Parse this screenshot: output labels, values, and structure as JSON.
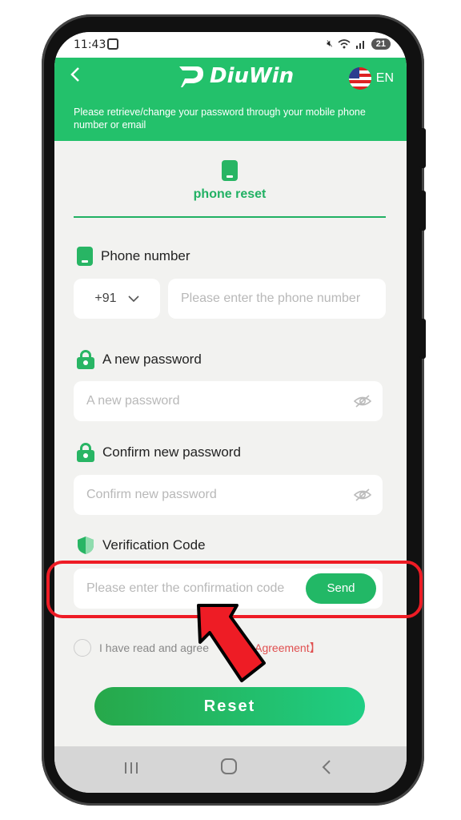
{
  "status_bar": {
    "time": "11:43",
    "battery": "21"
  },
  "header": {
    "back_icon": "chevron-left-icon",
    "brand": "DiuWin",
    "language": "EN",
    "description": "Please retrieve/change your password through your mobile phone number or email"
  },
  "tab": {
    "label": "phone reset"
  },
  "phone_section": {
    "label": "Phone number",
    "country_code": "+91",
    "placeholder": "Please enter the phone number"
  },
  "new_password": {
    "label": "A new password",
    "placeholder": "A new password"
  },
  "confirm_password": {
    "label": "Confirm new password",
    "placeholder": "Confirm new password"
  },
  "verification": {
    "label": "Verification Code",
    "placeholder": "Please enter the confirmation code",
    "send_label": "Send"
  },
  "agreement": {
    "text": "I have read and agree",
    "link": "cy Agreement】"
  },
  "reset_label": "Reset",
  "colors": {
    "brand_green": "#23c16b",
    "annotation_red": "#ee1c25",
    "link_red": "#e05050"
  }
}
